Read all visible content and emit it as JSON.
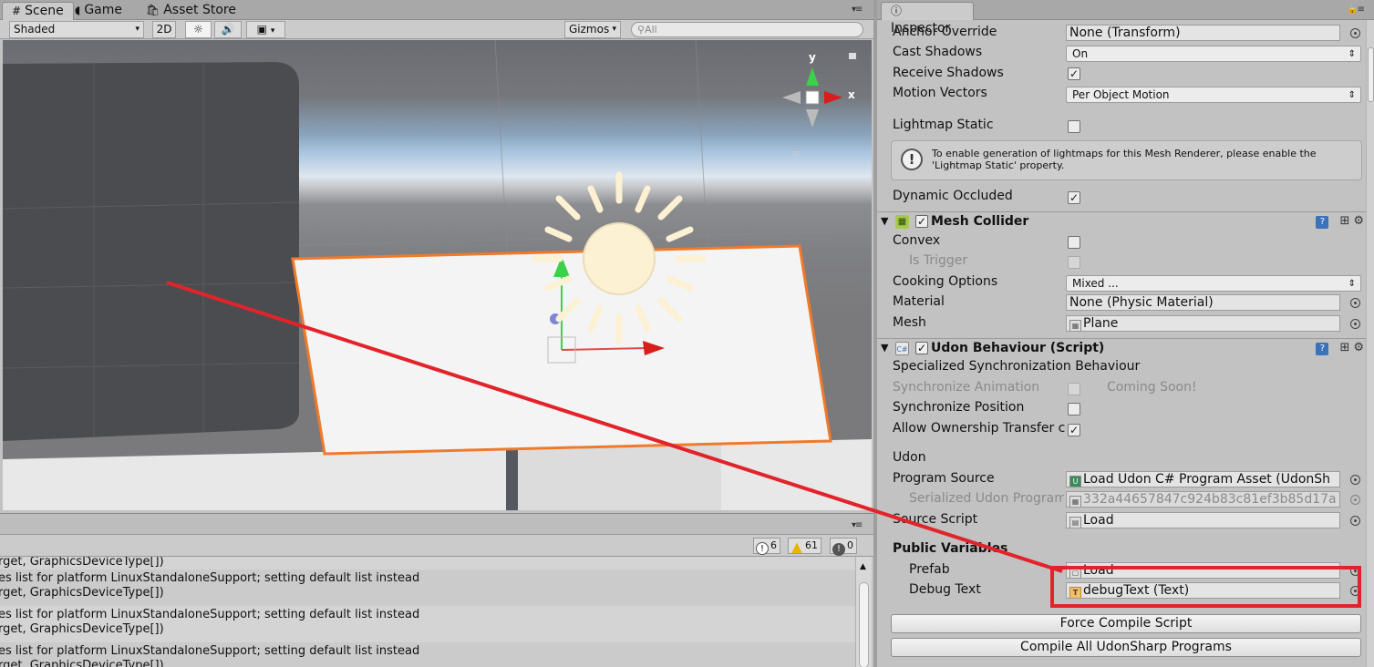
{
  "scene_panel": {
    "tabs": [
      {
        "label": "Scene",
        "icon": "hash-icon"
      },
      {
        "label": "Game",
        "icon": "pacman-icon"
      },
      {
        "label": "Asset Store",
        "icon": "bag-icon"
      }
    ],
    "toolbar": {
      "shading_mode": "Shaded",
      "btn_2d": "2D",
      "gizmos": "Gizmos",
      "search_placeholder": "All"
    },
    "gizmo": {
      "axis_y": "y",
      "axis_x": "x"
    }
  },
  "console": {
    "counters": {
      "info": "6",
      "warnings": "61",
      "errors": "0"
    },
    "rows": [
      "rget, GraphicsDeviceType[])",
      "es list for platform LinuxStandaloneSupport; setting default list instead",
      "rget, GraphicsDeviceType[])",
      "es list for platform LinuxStandaloneSupport; setting default list instead",
      "rget, GraphicsDeviceType[])",
      "es list for platform LinuxStandaloneSupport; setting default list instead",
      "rget, GraphicsDeviceType[])"
    ]
  },
  "inspector": {
    "tab_label": "Inspector",
    "mesh_renderer": {
      "anchor_override_label": "Anchor Override",
      "anchor_override_value": "None (Transform)",
      "cast_shadows_label": "Cast Shadows",
      "cast_shadows_value": "On",
      "receive_shadows_label": "Receive Shadows",
      "motion_vectors_label": "Motion Vectors",
      "motion_vectors_value": "Per Object Motion",
      "lightmap_static_label": "Lightmap Static",
      "help_text_1": "To enable generation of lightmaps for this Mesh Renderer, please enable the",
      "help_text_2": "'Lightmap Static' property.",
      "dynamic_occluded_label": "Dynamic Occluded"
    },
    "mesh_collider": {
      "title": "Mesh Collider",
      "convex_label": "Convex",
      "is_trigger_label": "Is Trigger",
      "cooking_options_label": "Cooking Options",
      "cooking_options_value": "Mixed ...",
      "material_label": "Material",
      "material_value": "None (Physic Material)",
      "mesh_label": "Mesh",
      "mesh_value": "Plane"
    },
    "udon_behaviour": {
      "title": "Udon Behaviour (Script)",
      "sync_heading": "Specialized Synchronization Behaviour",
      "sync_animation_label": "Synchronize Animation",
      "coming_soon": "Coming Soon!",
      "sync_position_label": "Synchronize Position",
      "allow_ownership_label": "Allow Ownership Transfer c",
      "udon_heading": "Udon",
      "program_source_label": "Program Source",
      "program_source_value": "Load Udon C# Program Asset (UdonSh",
      "serialized_label": "Serialized Udon Program",
      "serialized_value": "332a44657847c924b83c81ef3b85d17a",
      "source_script_label": "Source Script",
      "source_script_value": "Load",
      "public_vars_heading": "Public Variables",
      "prefab_label": "Prefab",
      "prefab_value": "Load",
      "debug_text_label": "Debug Text",
      "debug_text_value": "debugText (Text)",
      "force_compile_button": "Force Compile Script",
      "compile_all_button": "Compile All UdonSharp Programs"
    }
  },
  "colors": {
    "annotation_red": "#e2242a",
    "selection_orange": "#f07a2a",
    "sun_fill": "#fdf1d4"
  }
}
